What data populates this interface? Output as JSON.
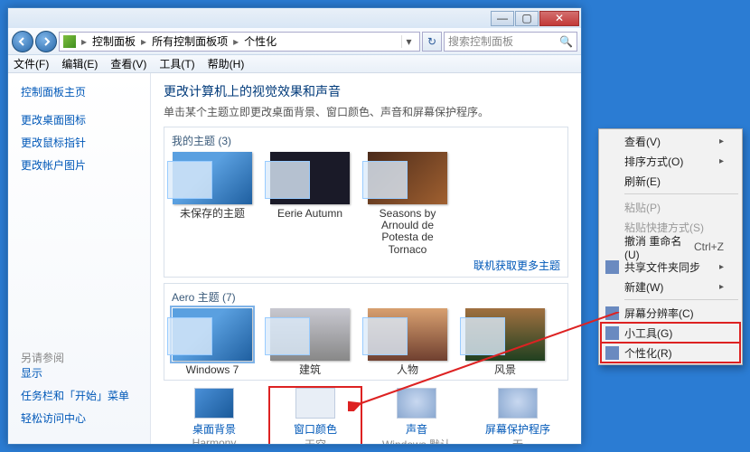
{
  "titlebar": {
    "min": "—",
    "max": "▢",
    "close": "✕"
  },
  "address": {
    "parts": [
      "控制面板",
      "所有控制面板项",
      "个性化"
    ],
    "search_placeholder": "搜索控制面板"
  },
  "menubar": [
    "文件(F)",
    "编辑(E)",
    "查看(V)",
    "工具(T)",
    "帮助(H)"
  ],
  "sidebar": {
    "links": [
      "控制面板主页",
      "更改桌面图标",
      "更改鼠标指针",
      "更改帐户图片"
    ],
    "see_also_label": "另请参阅",
    "see_also": [
      "显示",
      "任务栏和「开始」菜单",
      "轻松访问中心"
    ]
  },
  "content": {
    "title": "更改计算机上的视觉效果和声音",
    "subtitle": "单击某个主题立即更改桌面背景、窗口颜色、声音和屏幕保护程序。",
    "my_themes_label": "我的主题 (3)",
    "my_themes": [
      {
        "name": "未保存的主题"
      },
      {
        "name": "Eerie Autumn"
      },
      {
        "name": "Seasons by Arnould de Potesta de Tornaco"
      }
    ],
    "more_link": "联机获取更多主题",
    "aero_label": "Aero 主题 (7)",
    "aero_themes": [
      {
        "name": "Windows 7",
        "selected": true
      },
      {
        "name": "建筑"
      },
      {
        "name": "人物"
      },
      {
        "name": "风景"
      }
    ],
    "bottom": [
      {
        "label": "桌面背景",
        "value": "Harmony"
      },
      {
        "label": "窗口颜色",
        "value": "天空",
        "boxed": true
      },
      {
        "label": "声音",
        "value": "Windows 默认"
      },
      {
        "label": "屏幕保护程序",
        "value": "无"
      }
    ]
  },
  "context_menu": [
    {
      "label": "查看(V)",
      "submenu": true
    },
    {
      "label": "排序方式(O)",
      "submenu": true
    },
    {
      "label": "刷新(E)"
    },
    {
      "sep": true
    },
    {
      "label": "粘贴(P)",
      "disabled": true
    },
    {
      "label": "粘贴快捷方式(S)",
      "disabled": true
    },
    {
      "label": "撤消 重命名(U)",
      "shortcut": "Ctrl+Z"
    },
    {
      "label": "共享文件夹同步",
      "submenu": true,
      "icon": true
    },
    {
      "label": "新建(W)",
      "submenu": true
    },
    {
      "sep": true
    },
    {
      "label": "屏幕分辨率(C)",
      "icon": true
    },
    {
      "label": "小工具(G)",
      "icon": true,
      "boxed_group": true
    },
    {
      "label": "个性化(R)",
      "icon": true,
      "boxed_group": true
    }
  ]
}
